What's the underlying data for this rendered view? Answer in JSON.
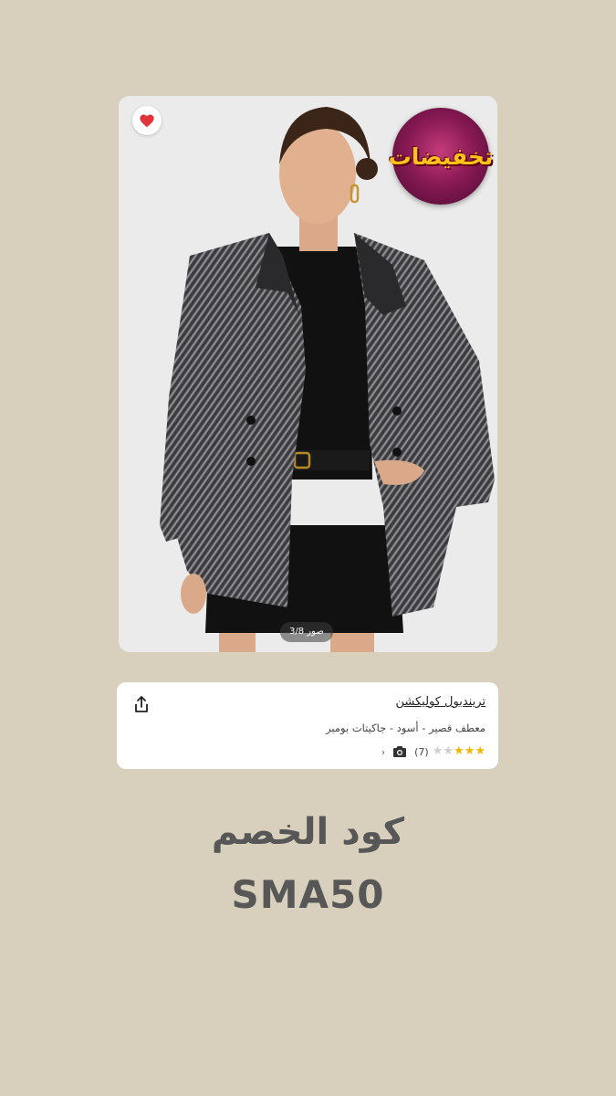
{
  "product": {
    "image_counter": "صور 3/8",
    "badge_text": "تخفيضات",
    "brand": "تريندبول كوليكشن",
    "description": "معطف قصير - أسود - جاكيتات بومبر",
    "rating": 3,
    "rating_max": 5,
    "review_count": "(7)",
    "icons": {
      "favorite": "heart-icon",
      "share": "share-icon",
      "photo": "camera-icon",
      "more": "chevron-left-icon"
    }
  },
  "promo": {
    "title": "كود الخصم",
    "code": "SMA50"
  },
  "colors": {
    "background": "#d8d0bd",
    "heart": "#e0343a",
    "star": "#f2b705",
    "badge_text": "#ffc21a"
  }
}
